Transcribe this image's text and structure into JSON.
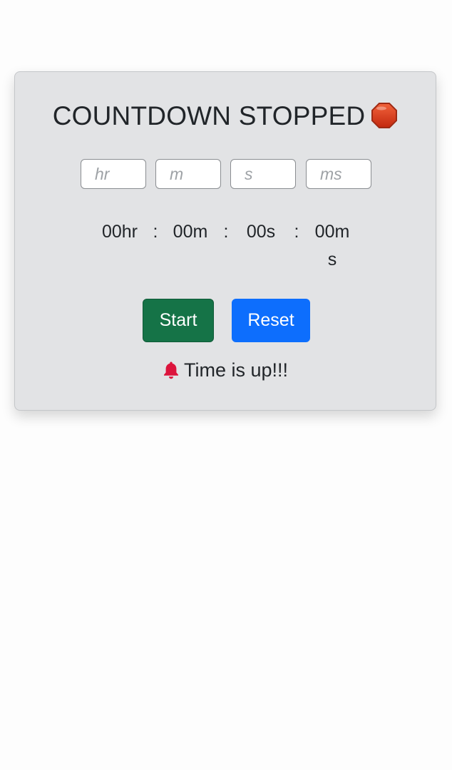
{
  "countdown": {
    "title": "COUNTDOWN STOPPED",
    "title_icon": "stop-sign-icon",
    "inputs": {
      "hours_placeholder": "hr",
      "minutes_placeholder": "m",
      "seconds_placeholder": "s",
      "milliseconds_placeholder": "ms"
    },
    "display": {
      "hours": "00hr",
      "minutes": "00m",
      "seconds": "00s",
      "milliseconds": "00ms",
      "separator": ":"
    },
    "buttons": {
      "start_label": "Start",
      "reset_label": "Reset"
    },
    "message": {
      "text": "Time is up!!!",
      "icon": "bell-icon"
    }
  },
  "colors": {
    "card_background": "#e2e3e5",
    "start_button": "#157347",
    "reset_button": "#0d6efd",
    "bell": "#dc143c",
    "stop_sign": "#d63d1e"
  }
}
